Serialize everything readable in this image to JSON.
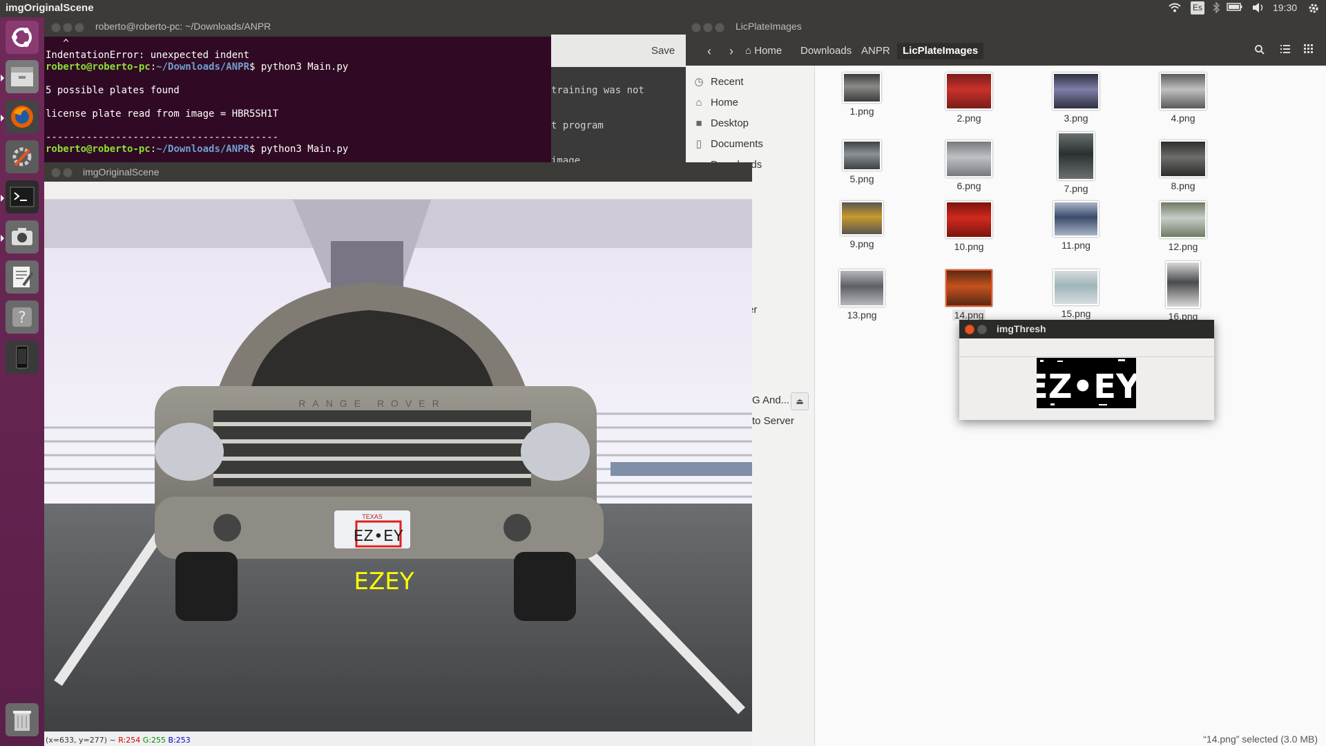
{
  "topbar": {
    "title": "imgOriginalScene",
    "keyboard_layout": "Es",
    "clock": "19:30"
  },
  "launcher": {
    "items": [
      "ubuntu-dash-icon",
      "files-icon",
      "firefox-icon",
      "system-settings-icon",
      "terminal-icon",
      "screenshot-icon",
      "text-editor-icon",
      "help-icon",
      "device-icon",
      "trash-icon"
    ]
  },
  "terminal": {
    "title": "roberto@roberto-pc: ~/Downloads/ANPR",
    "caret_line": "   ^",
    "error_line": "IndentationError: unexpected indent",
    "prompt1_user": "roberto@roberto-pc",
    "prompt1_path": "~/Downloads/ANPR",
    "prompt1_cmd": "$ python3 Main.py",
    "line_plates": "5 possible plates found",
    "line_read": "license plate read from image = HBR5SH1T",
    "line_dashes": "----------------------------------------",
    "prompt2_user": "roberto@roberto-pc",
    "prompt2_path": "~/Downloads/ANPR",
    "prompt2_cmd": "$ python3 Main.py"
  },
  "editor": {
    "save_label": "Save",
    "code_lines": [
      "training was not",
      "t program",
      "image"
    ]
  },
  "files": {
    "title": "LicPlateImages",
    "breadcrumbs": [
      "Home",
      "Downloads",
      "ANPR",
      "LicPlateImages"
    ],
    "sidebar": {
      "recent": "Recent",
      "home": "Home",
      "desktop": "Desktop",
      "documents": "Documents",
      "downloads": "Downloads",
      "partial1": "er",
      "partial2": "G And...",
      "partial3": "to Server"
    },
    "items": [
      "1.png",
      "2.png",
      "3.png",
      "4.png",
      "5.png",
      "6.png",
      "7.png",
      "8.png",
      "9.png",
      "10.png",
      "11.png",
      "12.png",
      "13.png",
      "14.png",
      "15.png",
      "16.png"
    ],
    "selected": "14.png",
    "status": "“14.png” selected  (3.0 MB)"
  },
  "scene": {
    "title": "imgOriginalScene",
    "recognized_text": "EZEY",
    "plate_text": "EZ•EY",
    "plate_state": "TEXAS",
    "grille_text": "RANGE ROVER",
    "coords_label": "(x=633, y=277) ~",
    "r_label": "R:254",
    "g_label": "G:255",
    "b_label": "B:253"
  },
  "thresh": {
    "title": "imgThresh",
    "plate_text": "EZ•EY."
  },
  "colors": {
    "accent_orange": "#e95420",
    "terminal_bg": "#300a24",
    "launcher_bg": "#6e2a58",
    "overlay_yellow": "#ffff00",
    "plate_box_red": "#e0201b"
  }
}
